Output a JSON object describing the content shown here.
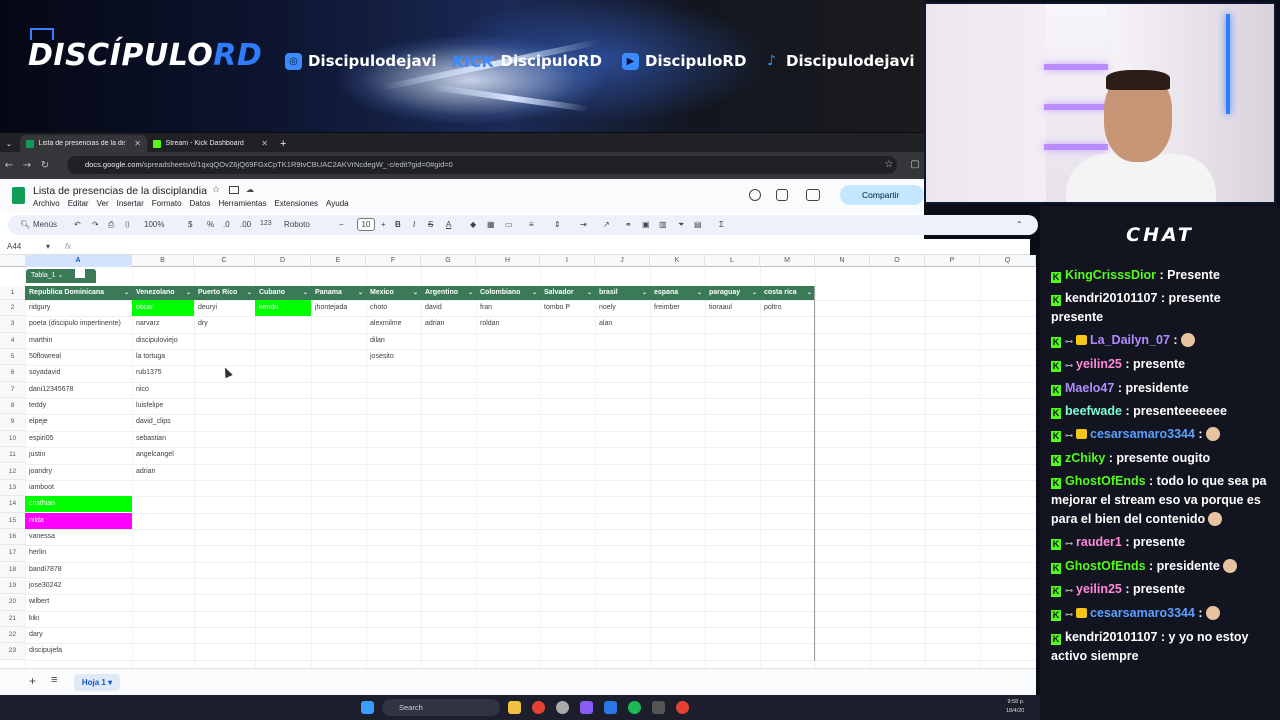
{
  "banner": {
    "brand_main": "DISCÍPULO",
    "brand_rd": "RD",
    "socials": [
      {
        "icon": "instagram-icon",
        "handle": "Discipulodejavi"
      },
      {
        "icon": "kick-logo",
        "label": "KICK",
        "handle": "DiscipuloRD"
      },
      {
        "icon": "youtube-icon",
        "handle": "DiscipuloRD"
      },
      {
        "icon": "tiktok-icon",
        "handle": "Discipulodejavi"
      }
    ]
  },
  "browser": {
    "tabs": [
      {
        "title": "Lista de presencias de la discip",
        "active": true,
        "icon": "sheets-icon"
      },
      {
        "title": "Stream - Kick Dashboard",
        "active": false,
        "icon": "kick-icon"
      }
    ],
    "url_host": "docs.google.com",
    "url_path": "/spreadsheets/d/1qxqQOvZ6jQ69FGxCpTK1R9tvCBUAC2AKVrNcdegW_-c/edit?gid=0#gid=0"
  },
  "docs": {
    "title": "Lista de presencias de la disciplandia",
    "menus": [
      "Archivo",
      "Editar",
      "Ver",
      "Insertar",
      "Formato",
      "Datos",
      "Herramientas",
      "Extensiones",
      "Ayuda"
    ],
    "share_label": "Compartir",
    "toolbar": {
      "menus": "Menús",
      "zoom": "100%",
      "percent": "%",
      "dec_minus": ".0",
      "dec_plus": ".00",
      "num_format": "123",
      "font": "Roboto",
      "font_size": "10",
      "bold": "B",
      "italic": "I"
    },
    "cell_ref": "A44",
    "fx": "fx"
  },
  "sheet": {
    "table_name": "Tabla_1",
    "col_letters": [
      "A",
      "B",
      "C",
      "D",
      "E",
      "F",
      "G",
      "H",
      "I",
      "J",
      "K",
      "L",
      "M",
      "N",
      "O",
      "P",
      "Q"
    ],
    "row_numbers": [
      "1",
      "2",
      "3",
      "4",
      "5",
      "6",
      "7",
      "8",
      "9",
      "10",
      "11",
      "12",
      "13",
      "14",
      "15",
      "16",
      "17",
      "18",
      "19",
      "20",
      "21",
      "22",
      "23"
    ],
    "headers": [
      "Republica Dominicana",
      "Venezolano",
      "Puerto Rico",
      "Cubano",
      "Panama",
      "Mexico",
      "Argentino",
      "Colombiano",
      "Salvador",
      "brasil",
      "espana",
      "paraguay",
      "costa rica"
    ],
    "columns": [
      [
        "ridgury",
        "poeta (discipulo impertinente)",
        "marthin",
        "50flowreal",
        "soyadavid",
        "dani12345678",
        "teddy",
        "elpeje",
        "espiri05",
        "justin",
        "joandry",
        "iamboot",
        "cristhian",
        "nilda",
        "vanessa",
        "herlin",
        "bandi7878",
        "jose30242",
        "wilbert",
        "kiki",
        "dary",
        "discipujefa"
      ],
      [
        "oscar",
        "narvarz",
        "discipuloviejo",
        "la tortuga",
        "rub1375",
        "nico",
        "luisfelipe",
        "david_clips",
        "sebastian",
        "angelcangel",
        "adrian"
      ],
      [
        "deuryi",
        "dry"
      ],
      [
        "kendri"
      ],
      [
        "jhontejada"
      ],
      [
        "choto",
        "alexmilme",
        "dilan",
        "josesito"
      ],
      [
        "david",
        "adrian"
      ],
      [
        "fran",
        "roldan"
      ],
      [
        "tombo P"
      ],
      [
        "noely",
        "alan"
      ],
      [
        "freimber"
      ],
      [
        "tioraaul"
      ],
      [
        "poltro"
      ]
    ],
    "highlights": {
      "green": "#00ff00",
      "magenta": "#ff00ff"
    },
    "sheet_tab": "Hoja 1"
  },
  "chat": {
    "title": "CHAT",
    "messages": [
      {
        "user": "KingCrisssDior",
        "color": "#53fc18",
        "text": ": Presente"
      },
      {
        "user": "kendri20101107",
        "color": "#ffffff",
        "text": ": presente presente"
      },
      {
        "user": "La_Dailyn_07",
        "color": "#b18cff",
        "text": ":"
      },
      {
        "user": "yeilin25",
        "color": "#ff8ad8",
        "text": ": presente"
      },
      {
        "user": "Maelo47",
        "color": "#b18cff",
        "text": ": presidente"
      },
      {
        "user": "beefwade",
        "color": "#7fffd4",
        "text": ": presenteeeeeee"
      },
      {
        "user": "cesarsamaro3344",
        "color": "#5aa0ff",
        "text": ":"
      },
      {
        "user": "zChiky",
        "color": "#53fc18",
        "text": ": presente ougito"
      },
      {
        "user": "GhostOfEnds",
        "color": "#53fc18",
        "text": ": todo lo que sea pa mejorar el stream eso va porque es para el bien del contenido"
      },
      {
        "user": "rauder1",
        "color": "#ff8ad8",
        "text": ": presente"
      },
      {
        "user": "GhostOfEnds",
        "color": "#53fc18",
        "text": ": presidente"
      },
      {
        "user": "yeilin25",
        "color": "#ff8ad8",
        "text": ": presente"
      },
      {
        "user": "cesarsamaro3344",
        "color": "#5aa0ff",
        "text": ":"
      },
      {
        "user": "kendri20101107",
        "color": "#ffffff",
        "text": ": y yo no estoy activo siempre"
      }
    ]
  },
  "taskbar": {
    "search": "Search",
    "time": "9:58 p.",
    "date": "18/4/20"
  }
}
